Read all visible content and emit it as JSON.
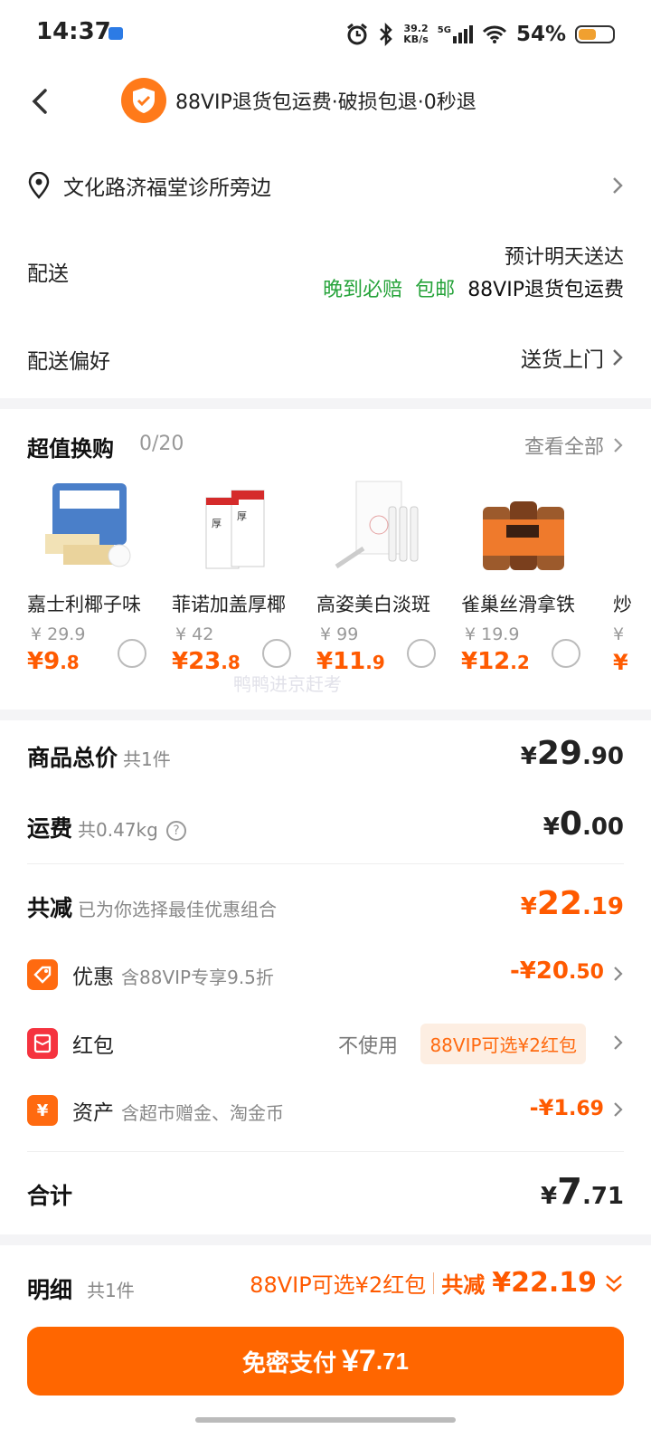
{
  "status_bar": {
    "time": "14:37",
    "net_speed_top": "39.2",
    "net_speed_bottom": "KB/s",
    "network": "5G",
    "battery_pct": "54%",
    "battery_level": 0.54,
    "icons": [
      "alarm-icon",
      "bluetooth-icon",
      "signal-icon",
      "wifi-icon",
      "battery-icon"
    ]
  },
  "header": {
    "title": "88VIP退货包运费·破损包退·0秒退"
  },
  "address": {
    "text": "文化路济福堂诊所旁边"
  },
  "shipping": {
    "label": "配送",
    "eta": "预计明天送达",
    "tag_late": "晚到必赔",
    "tag_free": "包邮",
    "tag_vip": "88VIP退货包运费"
  },
  "preference": {
    "label": "配送偏好",
    "value": "送货上门"
  },
  "exchange": {
    "title": "超值换购",
    "count": "0/20",
    "view_all": "查看全部",
    "watermark": "鸭鸭进京赶考",
    "products": [
      {
        "name": "嘉士利椰子味",
        "orig": "¥ 29.9",
        "price_int": "¥9",
        "price_dec": ".8"
      },
      {
        "name": "菲诺加盖厚椰",
        "orig": "¥ 42",
        "price_int": "¥23",
        "price_dec": ".8"
      },
      {
        "name": "高姿美白淡斑",
        "orig": "¥ 99",
        "price_int": "¥11",
        "price_dec": ".9"
      },
      {
        "name": "雀巢丝滑拿铁",
        "orig": "¥ 19.9",
        "price_int": "¥12",
        "price_dec": ".2"
      }
    ],
    "cut_off_name": "炒",
    "cut_off_orig": "¥",
    "cut_off_price": "¥"
  },
  "summary": {
    "goods_label": "商品总价",
    "goods_count": "共1件",
    "goods_cur": "¥",
    "goods_int": "29",
    "goods_dec": ".90",
    "freight_label": "运费",
    "freight_weight": "共0.47kg",
    "freight_cur": "¥",
    "freight_int": "0",
    "freight_dec": ".00",
    "reduce_label": "共减",
    "reduce_desc": "已为你选择最佳优惠组合",
    "reduce_cur": "¥",
    "reduce_int": "22",
    "reduce_dec": ".19",
    "discount_label": "优惠",
    "discount_desc": "含88VIP专享9.5折",
    "discount_int": "-¥20",
    "discount_dec": ".50",
    "redpack_label": "红包",
    "redpack_none": "不使用",
    "redpack_badge": "88VIP可选¥2红包",
    "asset_label": "资产",
    "asset_desc": "含超市赠金、淘金币",
    "asset_int": "-¥1",
    "asset_dec": ".69",
    "total_label": "合计",
    "total_cur": "¥",
    "total_int": "7",
    "total_dec": ".71"
  },
  "bottom": {
    "detail_label": "明细",
    "detail_count": "共1件",
    "vip_redpack": "88VIP可选¥2红包",
    "reduce_label": "共减",
    "reduce_value": "¥22.19",
    "pay_label": "免密支付",
    "pay_int": "¥7",
    "pay_dec": ".71"
  },
  "colors": {
    "accent": "#ff6600",
    "price": "#ff5a00",
    "green": "#26a33a"
  }
}
